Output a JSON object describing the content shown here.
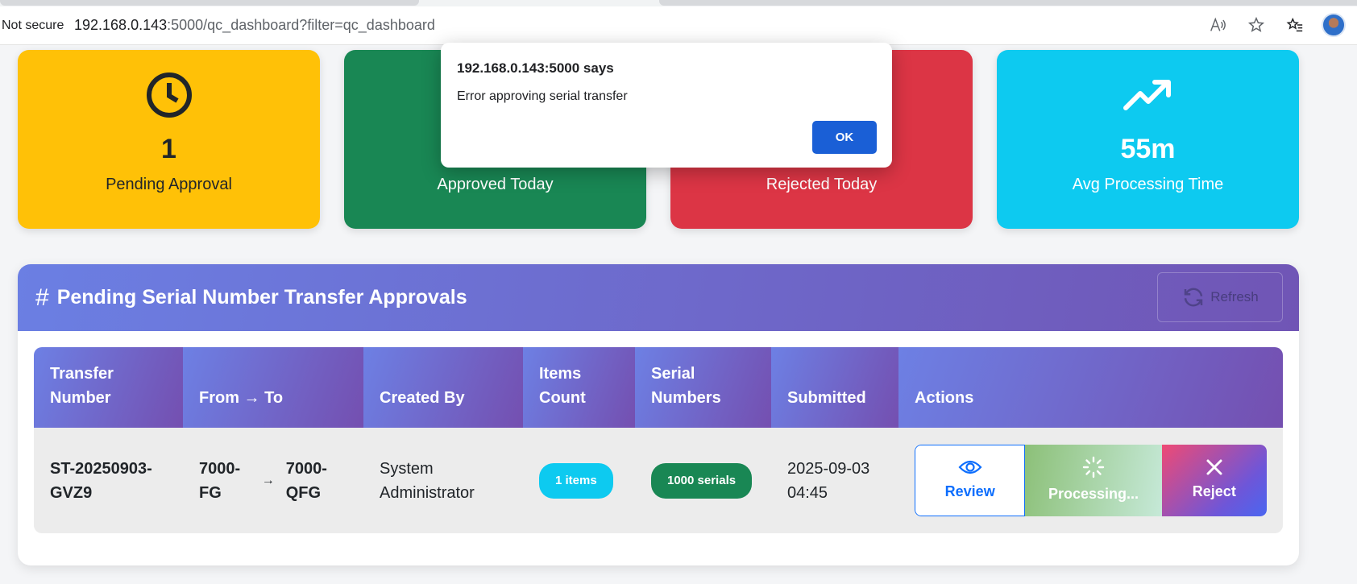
{
  "browser": {
    "security_label": "Not secure",
    "url_host": "192.168.0.143",
    "url_rest": ":5000/qc_dashboard?filter=qc_dashboard"
  },
  "stats": {
    "pending": {
      "value": "1",
      "label": "Pending Approval",
      "icon": "clock-icon"
    },
    "approved": {
      "value": "",
      "label": "Approved Today",
      "icon": "check-icon"
    },
    "rejected": {
      "value": "",
      "label": "Rejected Today",
      "icon": "x-icon"
    },
    "avg_time": {
      "value": "55m",
      "label": "Avg Processing Time",
      "icon": "trending-up-icon"
    }
  },
  "panel": {
    "title": "Pending Serial Number Transfer Approvals",
    "refresh_label": "Refresh"
  },
  "table": {
    "headers": [
      "Transfer Number",
      "From → To",
      "Created By",
      "Items Count",
      "Serial Numbers",
      "Submitted",
      "Actions"
    ],
    "rows": [
      {
        "transfer_number": "ST-20250903-GVZ9",
        "from": "7000-FG",
        "to": "7000-QFG",
        "created_by": "System Administrator",
        "items_count": "1 items",
        "serial_numbers": "1000 serials",
        "submitted": "2025-09-03 04:45",
        "actions": {
          "review": "Review",
          "processing": "Processing...",
          "reject": "Reject"
        }
      }
    ]
  },
  "dialog": {
    "title": "192.168.0.143:5000 says",
    "message": "Error approving serial transfer",
    "ok_label": "OK"
  },
  "colors": {
    "pending": "#ffc107",
    "approved": "#198754",
    "rejected": "#dc3545",
    "avg": "#0dcaf0",
    "header_gradient_start": "#6b7fe3",
    "header_gradient_end": "#7055b5"
  }
}
